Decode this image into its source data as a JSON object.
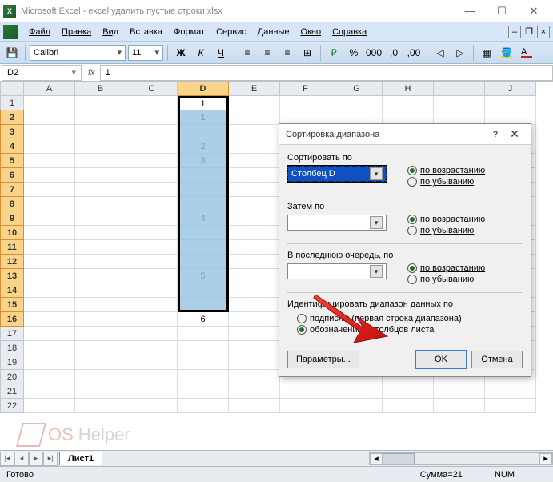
{
  "window": {
    "app_name": "Microsoft Excel",
    "file_name": "excel удалить пустые строки.xlsx",
    "full_title": "Microsoft Excel - excel удалить пустые строки.xlsx"
  },
  "menu": {
    "items": [
      "Файл",
      "Правка",
      "Вид",
      "Вставка",
      "Формат",
      "Сервис",
      "Данные",
      "Окно",
      "Справка"
    ]
  },
  "toolbar": {
    "font_name": "Calibri",
    "font_size": "11"
  },
  "formula_bar": {
    "cell_ref": "D2",
    "fx_label": "fx",
    "value": "1"
  },
  "grid": {
    "columns": [
      "A",
      "B",
      "C",
      "D",
      "E",
      "F",
      "G",
      "H",
      "I",
      "J"
    ],
    "rows": [
      "1",
      "2",
      "3",
      "4",
      "5",
      "6",
      "7",
      "8",
      "9",
      "10",
      "11",
      "12",
      "13",
      "14",
      "15",
      "16",
      "17",
      "18",
      "19",
      "20",
      "21",
      "22"
    ],
    "selected_column": "D",
    "selected_rows_start": 2,
    "selected_rows_end": 16,
    "cells_d": {
      "2": "1",
      "4": "2",
      "5": "3",
      "9": "4",
      "13": "5",
      "16": "6"
    }
  },
  "dialog": {
    "title": "Сортировка диапазона",
    "sort_by_label": "Сортировать по",
    "sort_by_value": "Столбец D",
    "then_by_label": "Затем по",
    "then_by_value": "",
    "last_by_label": "В последнюю очередь, по",
    "last_by_value": "",
    "ascending": "по возрастанию",
    "descending": "по убыванию",
    "identify_label": "Идентифицировать диапазон данных по",
    "radio_headers": "подписям (первая строка диапазона)",
    "radio_columns": "обозначениям столбцов листа",
    "options_btn": "Параметры...",
    "ok_btn": "OK",
    "cancel_btn": "Отмена"
  },
  "sheet_tabs": {
    "sheet1": "Лист1"
  },
  "status_bar": {
    "ready": "Готово",
    "sum": "Сумма=21",
    "num": "NUM"
  },
  "watermark": {
    "t1": "OS",
    "t2": "Helper"
  }
}
